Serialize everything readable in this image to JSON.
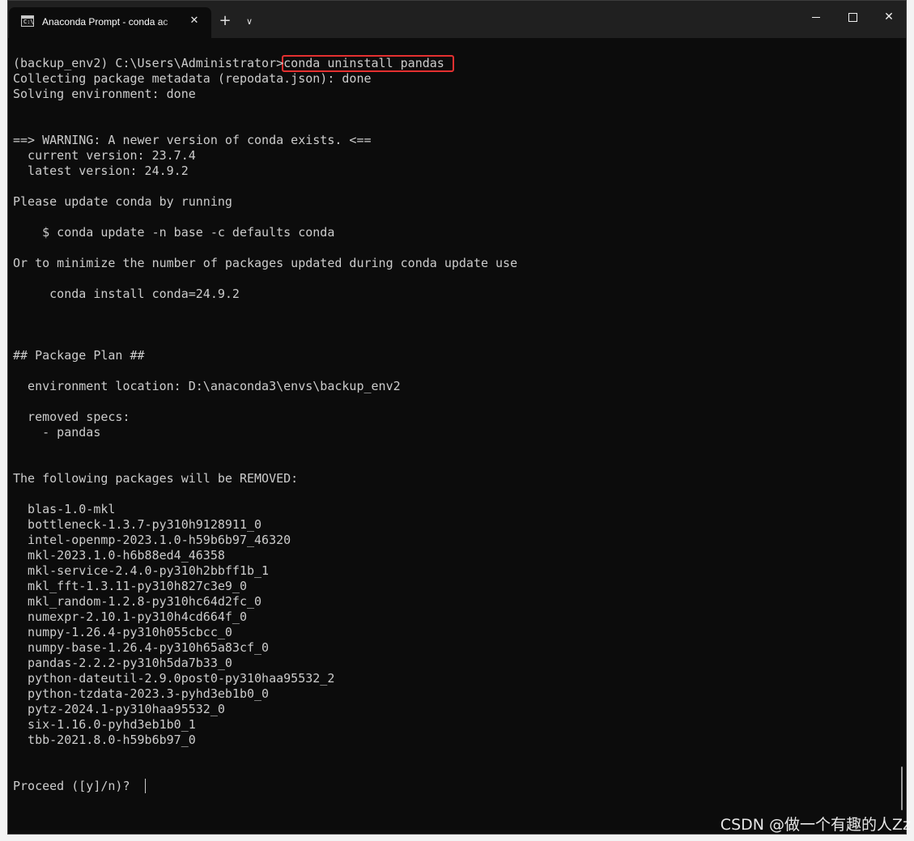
{
  "window": {
    "tab_title": "Anaconda Prompt - conda  ac",
    "tab_icon_glyph": "C:\\",
    "new_tab_glyph": "+",
    "dropdown_glyph": "∨",
    "close_tab_glyph": "✕",
    "close_glyph": "✕"
  },
  "terminal": {
    "lines": [
      "(backup_env2) C:\\Users\\Administrator>conda uninstall pandas",
      "Collecting package metadata (repodata.json): done",
      "Solving environment: done",
      "",
      "",
      "==> WARNING: A newer version of conda exists. <==",
      "  current version: 23.7.4",
      "  latest version: 24.9.2",
      "",
      "Please update conda by running",
      "",
      "    $ conda update -n base -c defaults conda",
      "",
      "Or to minimize the number of packages updated during conda update use",
      "",
      "     conda install conda=24.9.2",
      "",
      "",
      "",
      "## Package Plan ##",
      "",
      "  environment location: D:\\anaconda3\\envs\\backup_env2",
      "",
      "  removed specs:",
      "    - pandas",
      "",
      "",
      "The following packages will be REMOVED:",
      "",
      "  blas-1.0-mkl",
      "  bottleneck-1.3.7-py310h9128911_0",
      "  intel-openmp-2023.1.0-h59b6b97_46320",
      "  mkl-2023.1.0-h6b88ed4_46358",
      "  mkl-service-2.4.0-py310h2bbff1b_1",
      "  mkl_fft-1.3.11-py310h827c3e9_0",
      "  mkl_random-1.2.8-py310hc64d2fc_0",
      "  numexpr-2.10.1-py310h4cd664f_0",
      "  numpy-1.26.4-py310h055cbcc_0",
      "  numpy-base-1.26.4-py310h65a83cf_0",
      "  pandas-2.2.2-py310h5da7b33_0",
      "  python-dateutil-2.9.0post0-py310haa95532_2",
      "  python-tzdata-2023.3-pyhd3eb1b0_0",
      "  pytz-2024.1-py310haa95532_0",
      "  six-1.16.0-pyhd3eb1b0_1",
      "  tbb-2021.8.0-h59b6b97_0",
      "",
      "",
      "Proceed ([y]/n)? "
    ]
  },
  "watermark": "CSDN @做一个有趣的人Zz",
  "colors": {
    "terminal_bg": "#0c0c0c",
    "terminal_fg": "#cccccc",
    "titlebar_bg": "#202020",
    "highlight_border": "#e53030"
  }
}
